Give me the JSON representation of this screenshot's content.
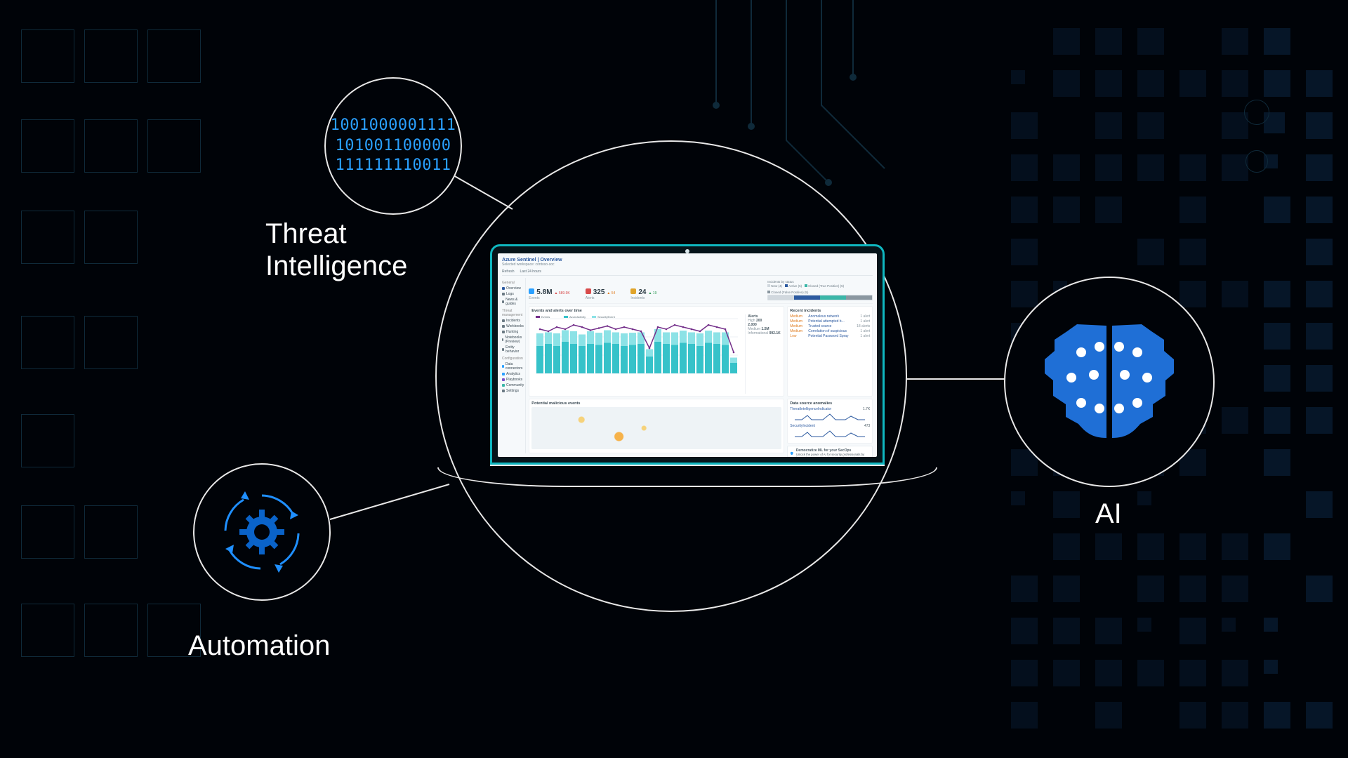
{
  "labels": {
    "threat_intelligence": "Threat\nIntelligence",
    "automation": "Automation",
    "ai": "AI"
  },
  "binary_lines": [
    "1001000001111",
    "101001100000",
    "111111110011"
  ],
  "dashboard": {
    "title": "Azure Sentinel | Overview",
    "subtitle": "Selected workspace: contoso-soc",
    "toolbar": [
      "Refresh",
      "Last 24 hours"
    ],
    "sidebar": {
      "groups": [
        {
          "name": "General",
          "items": [
            {
              "label": "Overview",
              "color": "#2c5aa0"
            },
            {
              "label": "Logs",
              "color": "#6b7a84"
            },
            {
              "label": "News & guides",
              "color": "#6b7a84"
            }
          ]
        },
        {
          "name": "Threat management",
          "items": [
            {
              "label": "Incidents",
              "color": "#6b7a84"
            },
            {
              "label": "Workbooks",
              "color": "#6b7a84"
            },
            {
              "label": "Hunting",
              "color": "#6b7a84"
            },
            {
              "label": "Notebooks (Preview)",
              "color": "#6b7a84"
            },
            {
              "label": "Entity behavior",
              "color": "#6b7a84"
            }
          ]
        },
        {
          "name": "Configuration",
          "items": [
            {
              "label": "Data connectors",
              "color": "#2aa0ff"
            },
            {
              "label": "Analytics",
              "color": "#2aa0ff"
            },
            {
              "label": "Playbooks",
              "color": "#7a51c9"
            },
            {
              "label": "Community",
              "color": "#3ab6a8"
            },
            {
              "label": "Settings",
              "color": "#6b7a84"
            }
          ]
        }
      ]
    },
    "kpis": {
      "events": {
        "value": "5.8M",
        "delta": "589.9K",
        "delta_color": "#d84a4a",
        "icon": "#2aa0ff",
        "label": "Events"
      },
      "alerts": {
        "value": "325",
        "delta": "54",
        "delta_color": "#e07c1f",
        "icon": "#d84a4a",
        "label": "Alerts"
      },
      "incidents": {
        "value": "24",
        "delta": "19",
        "delta_color": "#2a9a52",
        "icon": "#e0a42a",
        "label": "Incidents"
      }
    },
    "incident_status": {
      "title": "Incidents by status",
      "segments": [
        {
          "label": "New (4)",
          "color": "#d1d8de"
        },
        {
          "label": "Active (5)",
          "color": "#2c5aa0"
        },
        {
          "label": "Closed (True Positive) (5)",
          "color": "#3ab6a8"
        },
        {
          "label": "Closed (False Positive) (5)",
          "color": "#8a97a0"
        }
      ]
    },
    "events_chart": {
      "title": "Events and alerts over time",
      "legend": [
        {
          "label": "Events",
          "color": "#742f8a"
        },
        {
          "label": "AzureActivity",
          "color": "#36c2c9"
        },
        {
          "label": "SecurityEvent",
          "color": "#8ce2e6"
        }
      ],
      "line_series": [
        2.1,
        2.0,
        2.2,
        2.1,
        2.3,
        2.2,
        2.05,
        2.15,
        2.25,
        2.1,
        2.2,
        2.1,
        2.0,
        1.2,
        2.2,
        2.1,
        2.3,
        2.2,
        2.1,
        2.0,
        2.3,
        2.2,
        2.1,
        1.0
      ],
      "bars_a": [
        1.3,
        1.4,
        1.3,
        1.5,
        1.4,
        1.3,
        1.4,
        1.35,
        1.45,
        1.4,
        1.3,
        1.35,
        1.4,
        0.8,
        1.5,
        1.4,
        1.35,
        1.45,
        1.4,
        1.3,
        1.45,
        1.4,
        1.35,
        0.5
      ],
      "bars_b": [
        0.6,
        0.55,
        0.6,
        0.55,
        0.6,
        0.55,
        0.6,
        0.58,
        0.6,
        0.55,
        0.6,
        0.58,
        0.55,
        0.35,
        0.6,
        0.55,
        0.6,
        0.58,
        0.55,
        0.6,
        0.58,
        0.55,
        0.6,
        0.25
      ],
      "y_max": 2.6,
      "alerts_side": [
        {
          "label": "High",
          "value": "200"
        },
        {
          "label": "",
          "value": "2,000"
        },
        {
          "label": "Medium",
          "value": "1.5M"
        },
        {
          "label": "Informational",
          "value": "992.1K"
        }
      ]
    },
    "map_panel": {
      "title": "Potential malicious events"
    },
    "right_panels": {
      "recent_incidents": {
        "title": "Recent incidents",
        "rows": [
          {
            "sev": "Medium",
            "name": "Anomalous network",
            "alerts": "1 alert"
          },
          {
            "sev": "Medium",
            "name": "Potential attempted b...",
            "alerts": "1 alert"
          },
          {
            "sev": "Medium",
            "name": "Trusted source",
            "alerts": "18 alerts"
          },
          {
            "sev": "Medium",
            "name": "Correlation of suspicious",
            "alerts": "1 alert"
          },
          {
            "sev": "Low",
            "name": "Potential Password Spray",
            "alerts": "1 alert"
          }
        ]
      },
      "anomalies": {
        "title": "Data source anomalies",
        "items": [
          {
            "name": "ThreatIntelligenceIndicator",
            "v": "1.7K"
          },
          {
            "name": "SecurityIncident",
            "v": "473"
          }
        ]
      },
      "promo": {
        "title": "Democratize ML for your SecOps",
        "text": "Unlock the power of AI for security professionals by leveraging ML cutting edge research to evaluate individual or group anomalous behavior."
      }
    }
  }
}
